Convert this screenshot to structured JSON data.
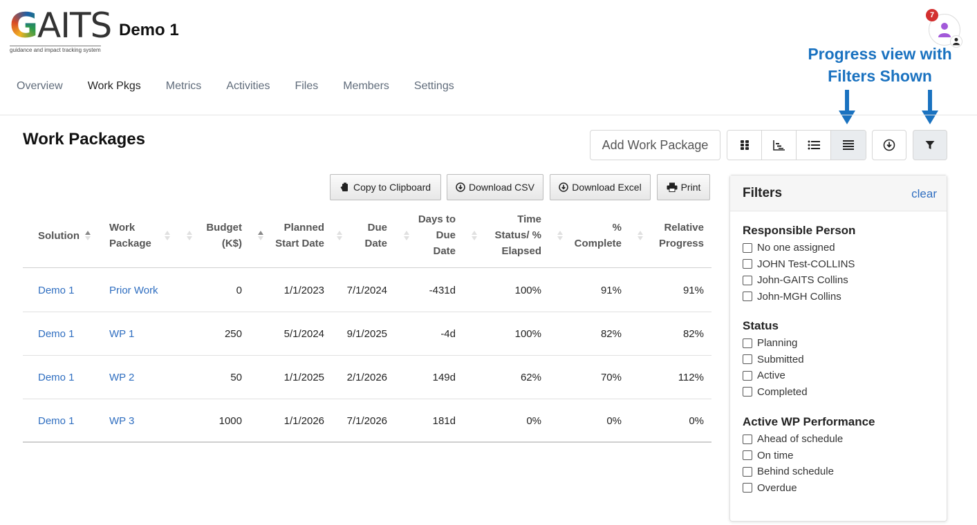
{
  "app": {
    "logo_text": "GAITS",
    "logo_tagline": "guidance and impact tracking system",
    "project_title": "Demo 1",
    "notification_count": "7"
  },
  "annotation": {
    "line1": "Progress view with",
    "line2": "Filters Shown",
    "color": "#1a72c0"
  },
  "nav": {
    "items": [
      {
        "label": "Overview"
      },
      {
        "label": "Work Pkgs"
      },
      {
        "label": "Metrics"
      },
      {
        "label": "Activities"
      },
      {
        "label": "Files"
      },
      {
        "label": "Members"
      },
      {
        "label": "Settings"
      }
    ],
    "active": "Work Pkgs"
  },
  "page": {
    "heading": "Work Packages",
    "add_button": "Add Work Package",
    "view_buttons": [
      "grid-view-icon",
      "chart-view-icon",
      "list-view-icon",
      "progress-view-icon"
    ],
    "selected_view": "progress-view-icon"
  },
  "export": {
    "copy": "Copy to Clipboard",
    "csv": "Download CSV",
    "excel": "Download Excel",
    "print": "Print"
  },
  "table": {
    "headers": {
      "solution": "Solution",
      "work_package_1": "Work",
      "work_package_2": "Package",
      "budget_1": "Budget",
      "budget_2": "(K$)",
      "planned_1": "Planned",
      "planned_2": "Start Date",
      "due_1": "Due",
      "due_2": "Date",
      "days_1": "Days to",
      "days_2": "Due",
      "days_3": "Date",
      "time_1": "Time",
      "time_2": "Status/ %",
      "time_3": "Elapsed",
      "pct_1": "%",
      "pct_2": "Complete",
      "rel_1": "Relative",
      "rel_2": "Progress"
    },
    "rows": [
      {
        "solution": "Demo 1",
        "work_package": "Prior Work",
        "budget": "0",
        "planned_start": "1/1/2023",
        "due": "7/1/2024",
        "days_to_due": "-431d",
        "time_elapsed": "100%",
        "complete": "91%",
        "relative": "91%"
      },
      {
        "solution": "Demo 1",
        "work_package": "WP 1",
        "budget": "250",
        "planned_start": "5/1/2024",
        "due": "9/1/2025",
        "days_to_due": "-4d",
        "time_elapsed": "100%",
        "complete": "82%",
        "relative": "82%"
      },
      {
        "solution": "Demo 1",
        "work_package": "WP 2",
        "budget": "50",
        "planned_start": "1/1/2025",
        "due": "2/1/2026",
        "days_to_due": "149d",
        "time_elapsed": "62%",
        "complete": "70%",
        "relative": "112%"
      },
      {
        "solution": "Demo 1",
        "work_package": "WP 3",
        "budget": "1000",
        "planned_start": "1/1/2026",
        "due": "7/1/2026",
        "days_to_due": "181d",
        "time_elapsed": "0%",
        "complete": "0%",
        "relative": "0%"
      }
    ]
  },
  "filters": {
    "title": "Filters",
    "clear": "clear",
    "groups": [
      {
        "title": "Responsible Person",
        "options": [
          "No one assigned",
          "JOHN Test-COLLINS",
          "John-GAITS Collins",
          "John-MGH Collins"
        ]
      },
      {
        "title": "Status",
        "options": [
          "Planning",
          "Submitted",
          "Active",
          "Completed"
        ]
      },
      {
        "title": "Active WP Performance",
        "options": [
          "Ahead of schedule",
          "On time",
          "Behind schedule",
          "Overdue"
        ]
      }
    ]
  },
  "colors": {
    "link": "#2f6ec0",
    "badge": "#d32f2f",
    "avatar": "#a259d9"
  }
}
